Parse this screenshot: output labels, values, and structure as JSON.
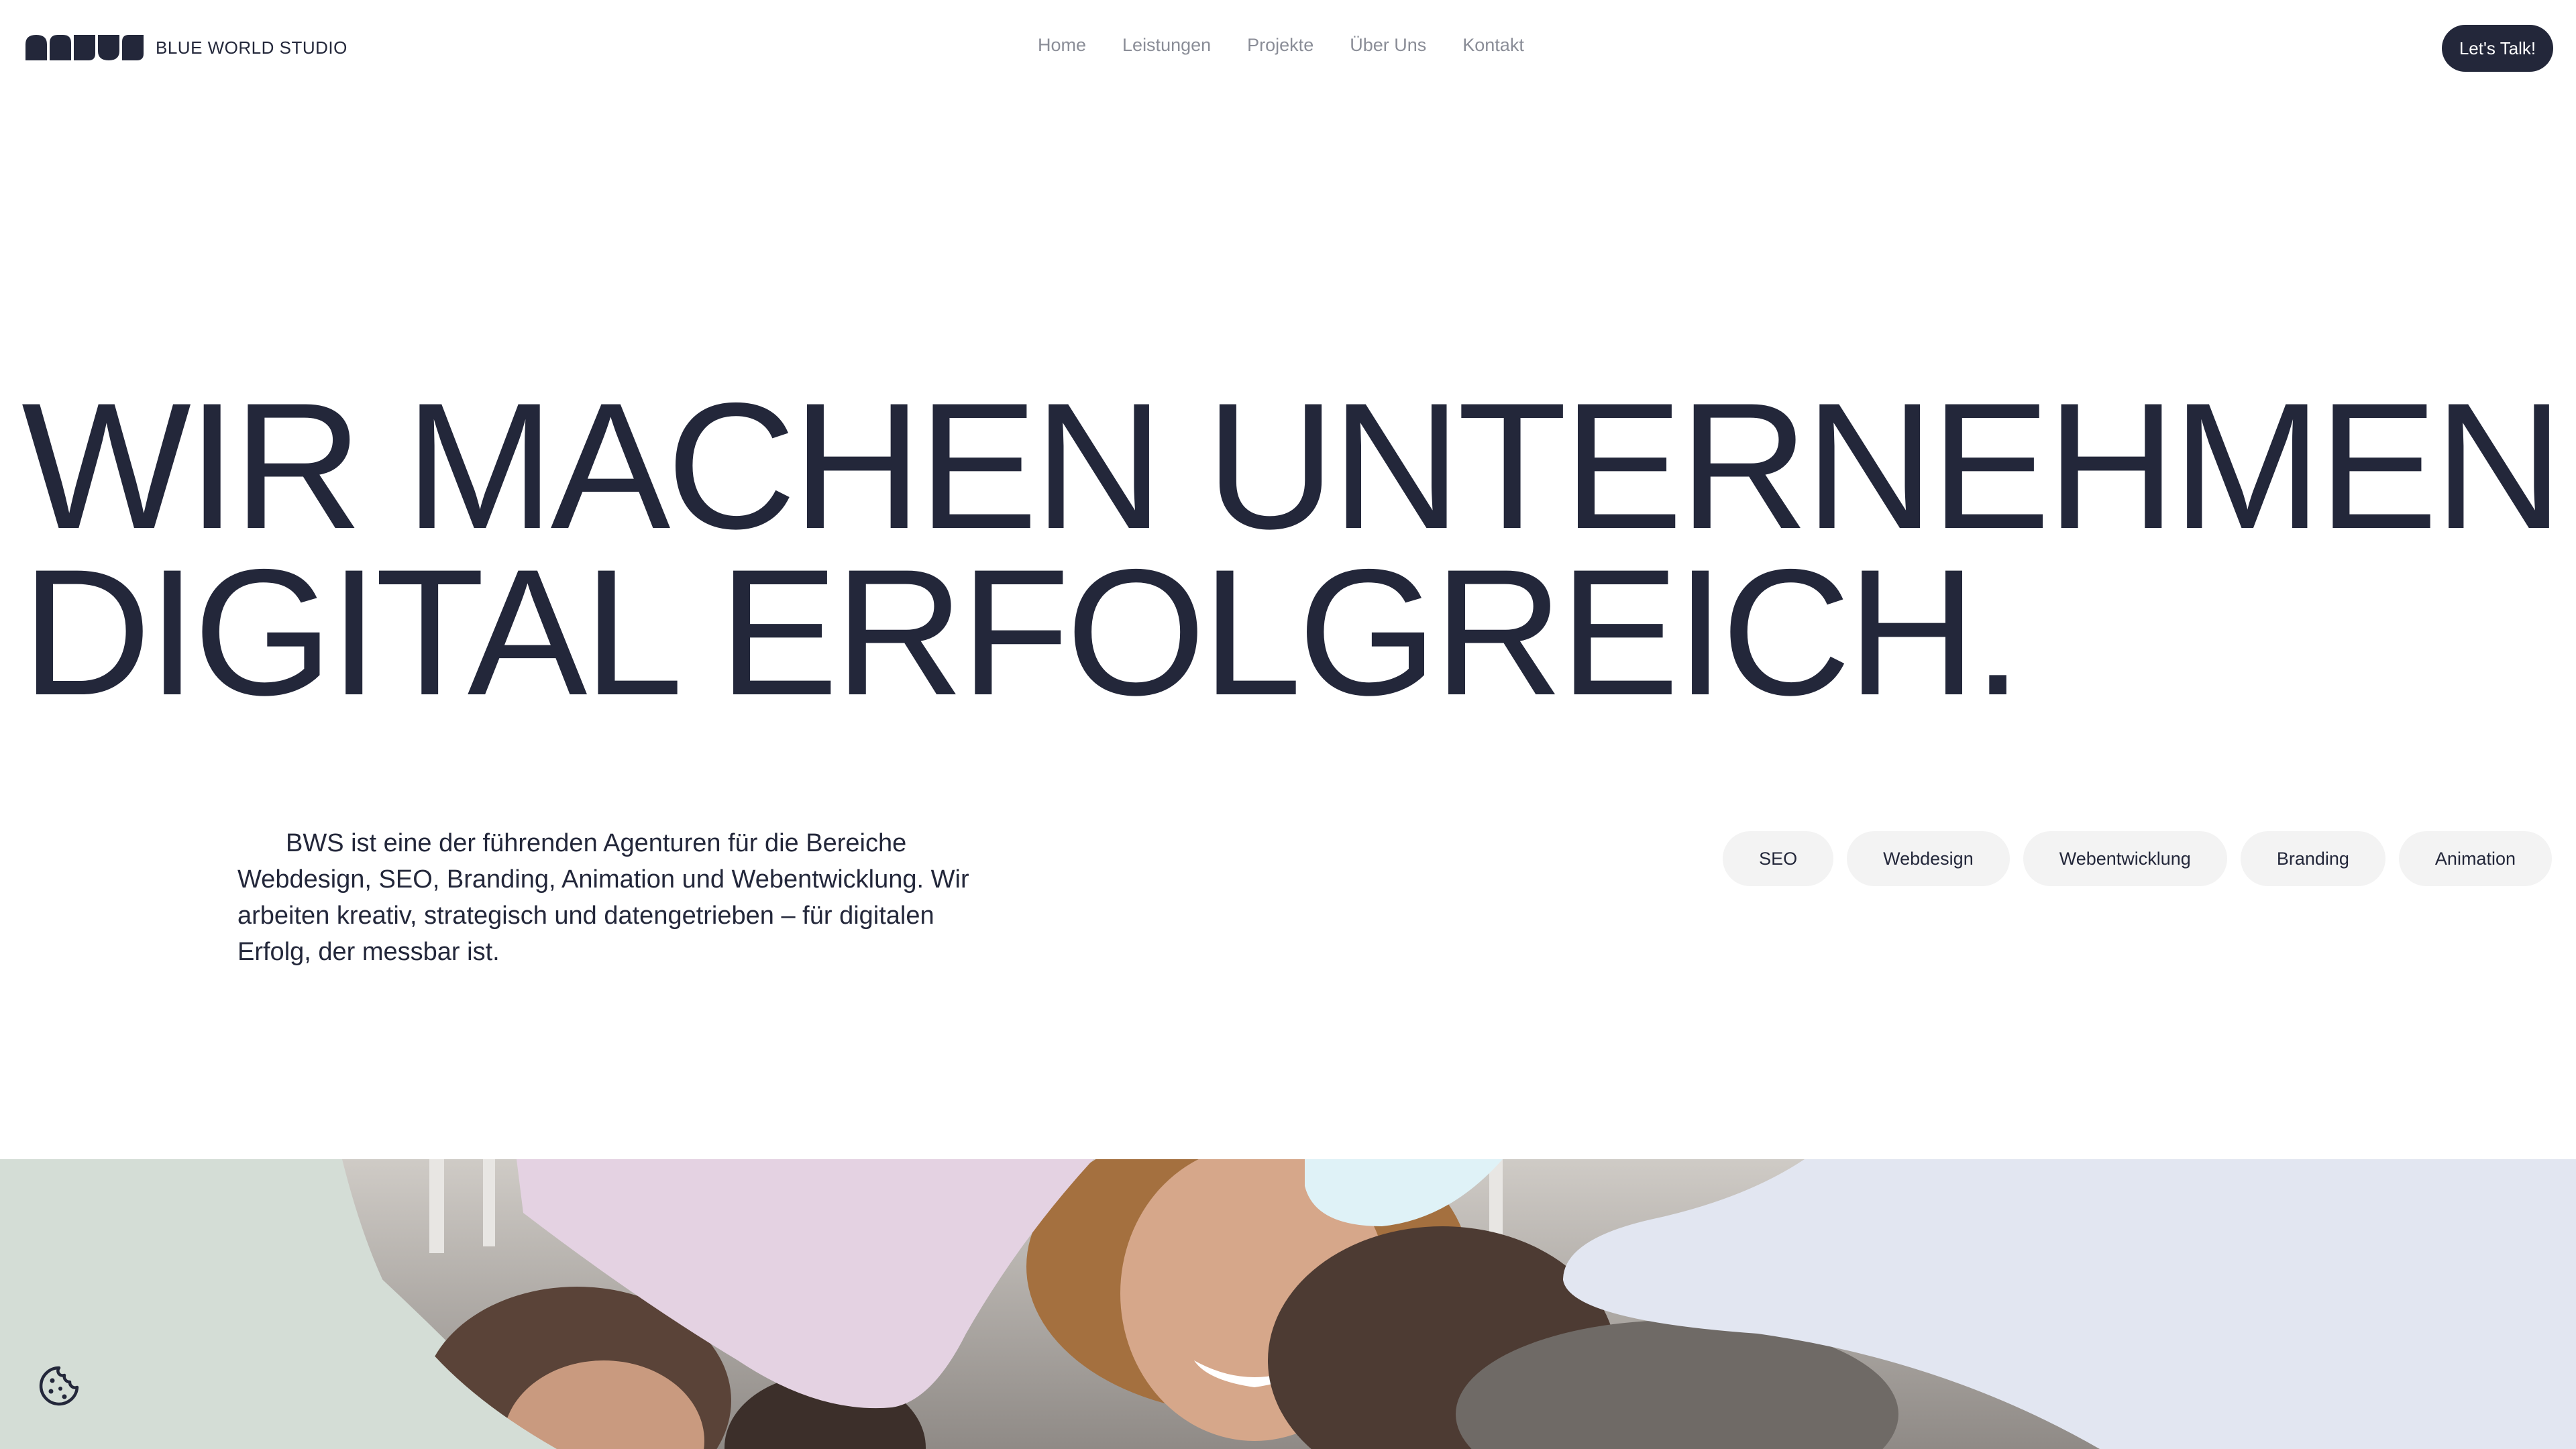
{
  "header": {
    "logo_text": "BLUE WORLD STUDIO",
    "nav": [
      "Home",
      "Leistungen",
      "Projekte",
      "Über Uns",
      "Kontakt"
    ],
    "cta_label": "Let's Talk!"
  },
  "hero": {
    "title_line_1": "WIR MACHEN UNTERNEHMEN",
    "title_line_2": "DIGITAL ERFOLGREICH."
  },
  "intro": {
    "text": "BWS ist eine der führenden Agenturen für die Bereiche Webdesign, SEO, Branding, Animation und Webentwicklung. Wir arbeiten kreativ, strategisch und datengetrieben – für digitalen Erfolg, der messbar ist."
  },
  "tags": [
    "SEO",
    "Webdesign",
    "Webentwicklung",
    "Branding",
    "Animation"
  ],
  "icons": {
    "logo": "brand-mark-icon",
    "cookie": "cookie-icon"
  },
  "colors": {
    "primary": "#23273a",
    "nav_text": "#8a8d97",
    "tag_bg": "#f3f3f3",
    "band_green": "#d4ddd6",
    "band_pink": "#e4d2e2",
    "band_lavender": "#e2e6f1",
    "band_cyan": "#dff2f7"
  }
}
